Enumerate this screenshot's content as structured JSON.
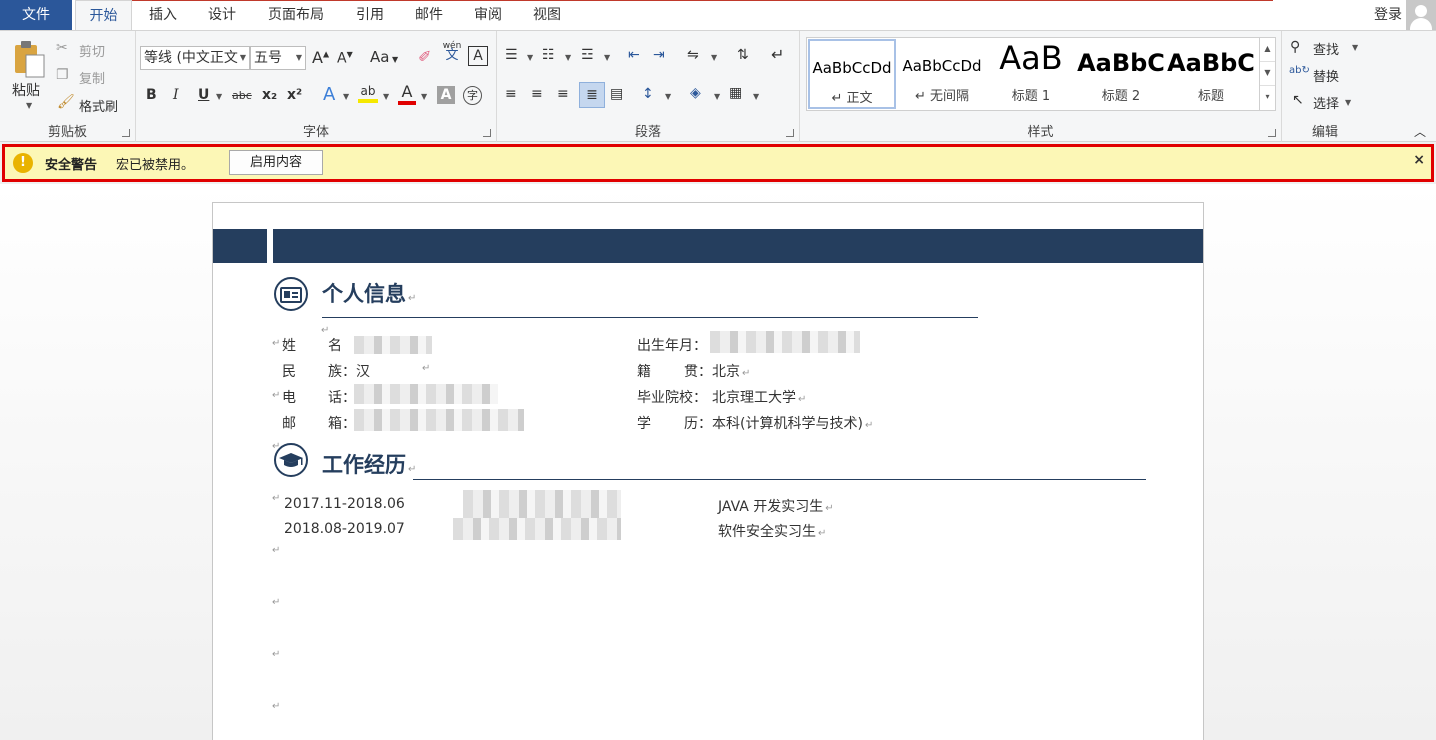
{
  "tabs": {
    "file": "文件",
    "home": "开始",
    "insert": "插入",
    "design": "设计",
    "layout": "页面布局",
    "references": "引用",
    "mailings": "邮件",
    "review": "审阅",
    "view": "视图",
    "login": "登录"
  },
  "clipboard": {
    "paste": "粘贴",
    "cut": "剪切",
    "copy": "复制",
    "format_painter": "格式刷",
    "label": "剪贴板"
  },
  "font": {
    "name": "等线 (中文正文",
    "size": "五号",
    "label": "字体",
    "grow": "A",
    "shrink": "A",
    "case": "Aa",
    "phonetic": "wén",
    "phonetic_char": "文",
    "border_char": "A",
    "bold": "B",
    "italic": "I",
    "underline": "U",
    "strike": "abc",
    "sub": "x₂",
    "sup": "x²",
    "effects": "A",
    "highlight": "ab",
    "color": "A",
    "shade": "A",
    "enclose": "字",
    "highlight_color": "#f5e800",
    "font_color": "#e00000"
  },
  "paragraph": {
    "label": "段落"
  },
  "styles": {
    "label": "样式",
    "items": [
      {
        "sample": "AaBbCcDd",
        "name": "↵ 正文"
      },
      {
        "sample": "AaBbCcDd",
        "name": "↵ 无间隔"
      },
      {
        "sample": "AaB",
        "name": "标题 1"
      },
      {
        "sample": "AaBbC",
        "name": "标题 2"
      },
      {
        "sample": "AaBbC",
        "name": "标题"
      }
    ]
  },
  "editing": {
    "label": "编辑",
    "find": "查找",
    "replace": "替换",
    "select": "选择"
  },
  "warning": {
    "title": "安全警告",
    "message": "宏已被禁用。",
    "button": "启用内容",
    "close": "×"
  },
  "document": {
    "banner_color": "#253e5e",
    "personal": {
      "title": "个人信息",
      "name_label_1": "姓",
      "name_label_2": "名",
      "birth_label": "出生年月：",
      "ethnic_label_1": "民",
      "ethnic_label_2": "族：",
      "ethnic_value": "汉",
      "origin_label_1": "籍",
      "origin_label_2": "贯：",
      "origin_value": "北京",
      "phone_label_1": "电",
      "phone_label_2": "话：",
      "school_label": "毕业院校：",
      "school_value": "北京理工大学",
      "email_label_1": "邮",
      "email_label_2": "箱：",
      "edu_label_1": "学",
      "edu_label_2": "历：",
      "edu_value": "本科(计算机科学与技术)"
    },
    "work": {
      "title": "工作经历",
      "entries": [
        {
          "period": "2017.11-2018.06",
          "role": "JAVA 开发实习生"
        },
        {
          "period": "2018.08-2019.07",
          "role": "软件安全实习生"
        }
      ]
    },
    "para_mark": "↵"
  }
}
